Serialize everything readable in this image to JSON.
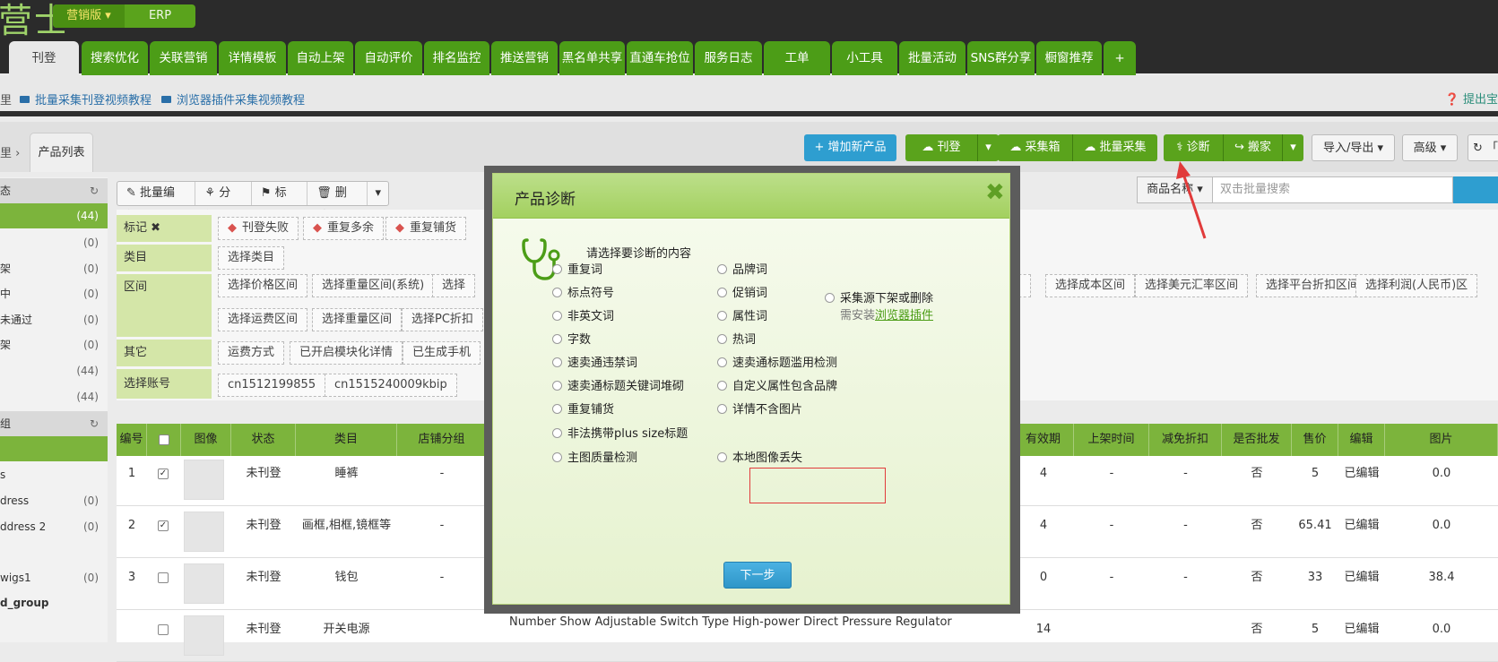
{
  "logo": {
    "text": "营士"
  },
  "edition": {
    "marketing": "营销版 ▾",
    "erp": "ERP"
  },
  "nav": [
    "刊登",
    "搜索优化",
    "关联营销",
    "详情模板",
    "自动上架",
    "自动评价",
    "排名监控",
    "推送营销",
    "黑名单共享",
    "直通车抢位",
    "服务日志",
    "工单",
    "小工具",
    "批量活动",
    "SNS群分享",
    "橱窗推荐",
    "+"
  ],
  "links": {
    "tut1": "批量采集刊登视频教程",
    "tut2": "浏览器插件采集视频教程",
    "help": "❓ 提出宝"
  },
  "breadcrumb": {
    "sep": "里 ›",
    "tab": "产品列表"
  },
  "toolbar": {
    "add": "+ 增加新产品",
    "publish": "☁ 刊登",
    "caret": "▾",
    "collect": "☁ 采集箱",
    "batch": "☁ 批量采集",
    "diagnose": "⚕ 诊断",
    "move": "↪ 搬家",
    "export": "导入/导出 ▾",
    "advanced": "高级 ▾",
    "refresh": "↻ 「"
  },
  "search": {
    "select": "商品名称 ▾",
    "placeholder": "双击批量搜索"
  },
  "actions": {
    "batch_edit": "✎ 批量编辑",
    "group": "⚘ 分组",
    "mark": "⚑ 标记",
    "delete": "🗑 删除",
    "more": "▾"
  },
  "sidebar": {
    "rows": [
      {
        "label": "态",
        "count": "↻",
        "type": "hdr"
      },
      {
        "label": "",
        "count": "(44)",
        "type": "sel"
      },
      {
        "label": "",
        "count": "(0)"
      },
      {
        "label": "架",
        "count": "(0)"
      },
      {
        "label": "中",
        "count": "(0)"
      },
      {
        "label": "未通过",
        "count": "(0)"
      },
      {
        "label": "架",
        "count": "(0)"
      },
      {
        "label": "",
        "count": "(44)"
      },
      {
        "label": "",
        "count": "(44)"
      },
      {
        "label": "组",
        "count": "↻",
        "type": "hdr"
      },
      {
        "label": "",
        "count": "",
        "type": "sel"
      },
      {
        "label": "s",
        "count": ""
      },
      {
        "label": "dress",
        "count": "(0)"
      },
      {
        "label": "ddress 2",
        "count": "(0)"
      },
      {
        "label": "",
        "count": ""
      },
      {
        "label": "wigs1",
        "count": "(0)"
      },
      {
        "label": "d_group",
        "count": ""
      }
    ]
  },
  "filters": {
    "mark_label": "标记 ✖",
    "marks": [
      "刊登失败",
      "重复多余",
      "重复铺货"
    ],
    "category_label": "类目",
    "category_chip": "选择类目",
    "range_label": "区间",
    "range_row1": [
      "选择价格区间",
      "选择重量区间(系统)",
      "选择"
    ],
    "range_row1_right": [
      "间",
      "选择成本区间",
      "选择美元汇率区间",
      "选择平台折扣区间",
      "选择利润(人民币)区"
    ],
    "range_row2": [
      "选择运费区间",
      "选择重量区间",
      "选择PC折扣"
    ],
    "other_label": "其它",
    "other_chips": [
      "运费方式",
      "已开启模块化详情",
      "已生成手机"
    ],
    "account_label": "选择账号",
    "accounts": [
      "cn1512199855",
      "cn1515240009kbip"
    ]
  },
  "table": {
    "headers": [
      "编号",
      "",
      "图像",
      "状态",
      "类目",
      "店铺分组",
      "有效期",
      "上架时间",
      "减免折扣",
      "是否批发",
      "售价",
      "编辑",
      "图片"
    ],
    "rows": [
      {
        "no": "1",
        "checked": true,
        "status": "未刊登",
        "category": "睡裤",
        "shop": "-",
        "valid": "4",
        "listed": "-",
        "discount": "-",
        "wholesale": "否",
        "price": "5",
        "edit": "已编辑",
        "img": "0.0"
      },
      {
        "no": "2",
        "checked": true,
        "status": "未刊登",
        "category": "画框,相框,镜框等",
        "shop": "-",
        "valid": "4",
        "listed": "-",
        "discount": "-",
        "wholesale": "否",
        "price": "65.41",
        "edit": "已编辑",
        "img": "0.0"
      },
      {
        "no": "3",
        "checked": false,
        "status": "未刊登",
        "category": "钱包",
        "shop": "-",
        "valid": "0",
        "listed": "-",
        "discount": "-",
        "wholesale": "否",
        "price": "33",
        "edit": "已编辑",
        "img": "38.4"
      },
      {
        "no": "",
        "checked": false,
        "status": "未刊登",
        "category": "开关电源",
        "shop": "",
        "valid": "14",
        "listed": "",
        "discount": "",
        "wholesale": "否",
        "price": "5",
        "edit": "已编辑",
        "img": "0.0"
      }
    ],
    "row4_title": "Number Show Adjustable Switch Type High-power Direct Pressure Regulator"
  },
  "modal": {
    "title": "产品诊断",
    "close": "✖",
    "prompt": "请选择要诊断的内容",
    "left_options": [
      "重复词",
      "标点符号",
      "非英文词",
      "字数",
      "速卖通违禁词",
      "速卖通标题关键词堆砌",
      "重复铺货",
      "非法携带plus size标题",
      "主图质量检测"
    ],
    "right_options": [
      "品牌词",
      "促销词",
      "属性词",
      "热词",
      "速卖通标题滥用检测",
      "自定义属性包含品牌",
      "详情不含图片",
      "本地图像丢失"
    ],
    "extra_option": "采集源下架或删除",
    "install_note": "需安装",
    "install_link": "浏览器插件",
    "next": "下一步"
  },
  "colors": {
    "accent": "#5aa31c",
    "nav_green": "#4c9d17",
    "blue": "#2e9ed0",
    "highlight": "#e13b3b"
  }
}
